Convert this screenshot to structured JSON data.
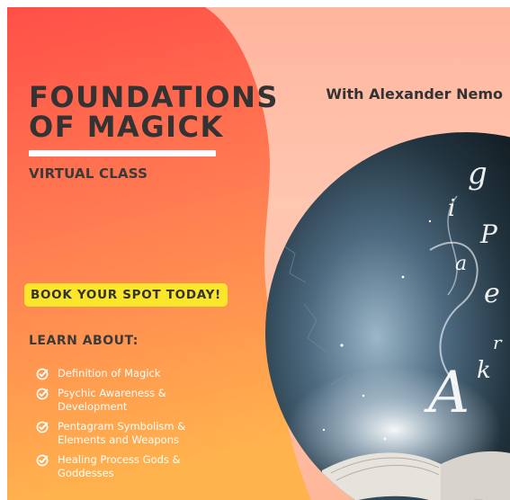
{
  "title": "FOUNDATIONS\nOF MAGICK",
  "subtitle": "VIRTUAL CLASS",
  "author": "With Alexander Nemo",
  "cta": "BOOK YOUR SPOT TODAY!",
  "learn_heading": "LEARN ABOUT:",
  "topics": [
    "Definition of Magick",
    "Psychic Awareness &\nDevelopment",
    "Pentagram Symbolism &\nElements and Weapons",
    "Healing Process Gods &\nGoddesses"
  ],
  "colors": {
    "accent_yellow": "#fbe62c",
    "coral": "#ff5a4a",
    "orange": "#ff9a4f",
    "peach_bg": "#ffc2aa",
    "text_dark": "#333333"
  },
  "icons": [
    "check-circle-icon",
    "open-book-icon"
  ]
}
